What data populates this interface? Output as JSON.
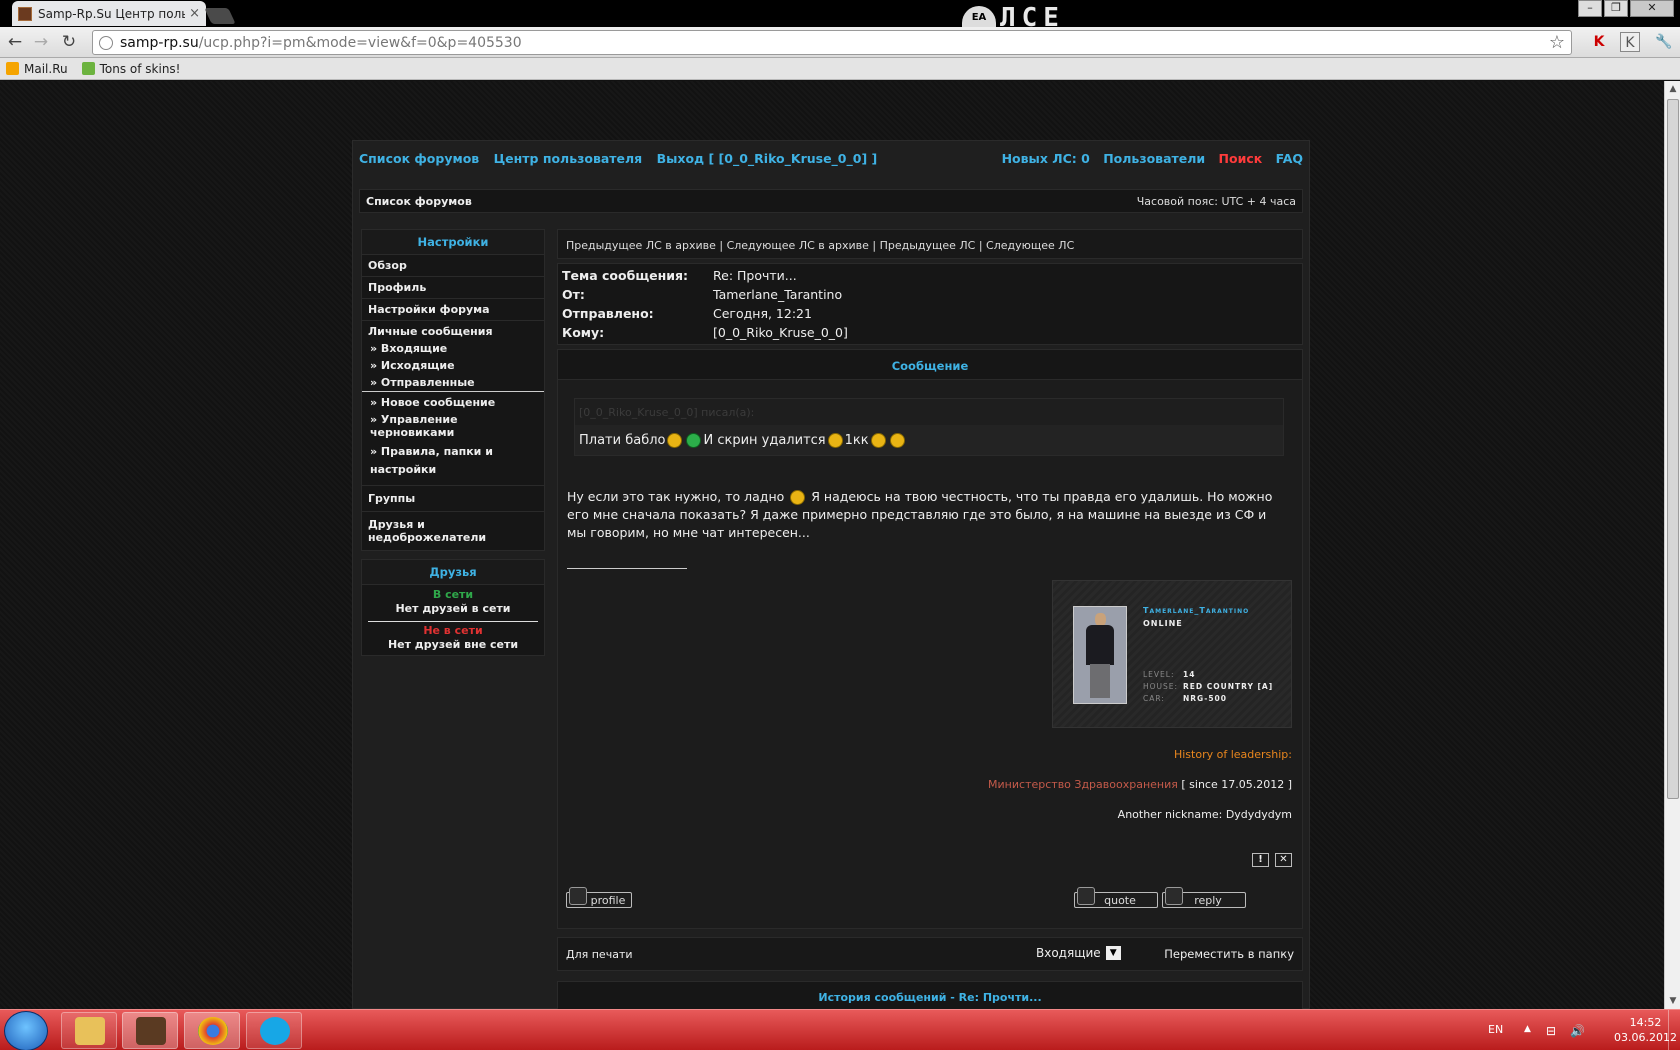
{
  "browser": {
    "tab_title": "Samp-Rp.Su Центр пользо",
    "tab_close": "×",
    "brand": "ЛСЕ",
    "ea_logo": "EA",
    "window_buttons": [
      "–",
      "❐",
      "✕"
    ],
    "url_host": "samp-rp.su",
    "url_path": "/ucp.php?i=pm&mode=view&f=0&p=405530",
    "back": "←",
    "forward": "→",
    "reload": "↻",
    "star": "☆",
    "ext1": "K",
    "ext2": "K",
    "wrench": "🔧",
    "bookmarks": [
      {
        "label": "Mail.Ru",
        "color": "#f5a400"
      },
      {
        "label": "Tons of skins!",
        "color": "#6cb33f"
      }
    ]
  },
  "forum": {
    "topnav_left": [
      "Список форумов",
      "Центр пользователя",
      "Выход [ [0_0_Riko_Kruse_0_0] ]"
    ],
    "topnav_right": [
      "Новых ЛС: 0",
      "Пользователи",
      "Поиск",
      "FAQ"
    ],
    "breadcrumb": "Список форумов",
    "timezone": "Часовой пояс: UTC + 4 часа",
    "sidebar": {
      "settings_title": "Настройки",
      "items": [
        "Обзор",
        "Профиль",
        "Настройки форума",
        "Личные сообщения"
      ],
      "pm_sub": [
        "» Входящие",
        "» Исходящие",
        "» Отправленные"
      ],
      "pm_sub2": [
        "» Новое сообщение",
        "» Управление черновиками",
        "» Правила, папки и настройки"
      ],
      "items2": [
        "Группы",
        "Друзья и недоброжелатели"
      ],
      "friends_title": "Друзья",
      "online": "В сети",
      "no_online": "Нет друзей в сети",
      "offline": "Не в сети",
      "no_offline": "Нет друзей вне сети"
    },
    "pm_nav": "Предыдущее ЛС в архиве | Следующее ЛС в архиве | Предыдущее ЛС | Следующее ЛС",
    "header": {
      "subject_label": "Тема сообщения:",
      "subject": "Re: Прочти...",
      "from_label": "От:",
      "from": "Tamerlane_Tarantino",
      "sent_label": "Отправлено:",
      "sent": "Сегодня, 12:21",
      "to_label": "Кому:",
      "to": "[0_0_Riko_Kruse_0_0]"
    },
    "message": {
      "title": "Сообщение",
      "quote_header": "[0_0_Riko_Kruse_0_0] писал(а):",
      "quote_a": "Плати бабло",
      "quote_b": "И скрин удалится",
      "quote_c": "1кк",
      "body_a": "Ну если это так нужно, то ладно",
      "body_b": "Я надеюсь на твою честность, что ты правда его удалишь. Но можно его мне сначала показать? Я даже примерно представляю где это было, я на машине на выезде из СФ и мы говорим, но мне чат интересен..."
    },
    "card": {
      "name": "Tamerlane_Tarantino",
      "status": "ONLINE",
      "level_label": "LEVEL:",
      "level": "14",
      "house_label": "HOUSE:",
      "house": "RED COUNTRY [A]",
      "car_label": "CAR:",
      "car": "NRG-500"
    },
    "signature": {
      "history": "History of leadership:",
      "ministry": "Министерство Здравоохранения",
      "since": " [ since 17.05.2012 ]",
      "another": "Another nickname: Dydydydym"
    },
    "icons": {
      "report": "!",
      "delete": "✕"
    },
    "buttons": {
      "profile": "profile",
      "quote": "quote",
      "reply": "reply"
    },
    "actions": {
      "print": "Для печати",
      "folder": "Входящие",
      "folder_arrow": "▼",
      "move": "Переместить в папку"
    },
    "history_title": "История сообщений - Re: Прочти..."
  },
  "taskbar": {
    "lang": "EN",
    "time": "14:52",
    "date": "03.06.2012",
    "tray_up": "▲",
    "tray_net": "⊟",
    "tray_vol": "🔊"
  },
  "scroll": {
    "up": "▲",
    "down": "▼"
  }
}
